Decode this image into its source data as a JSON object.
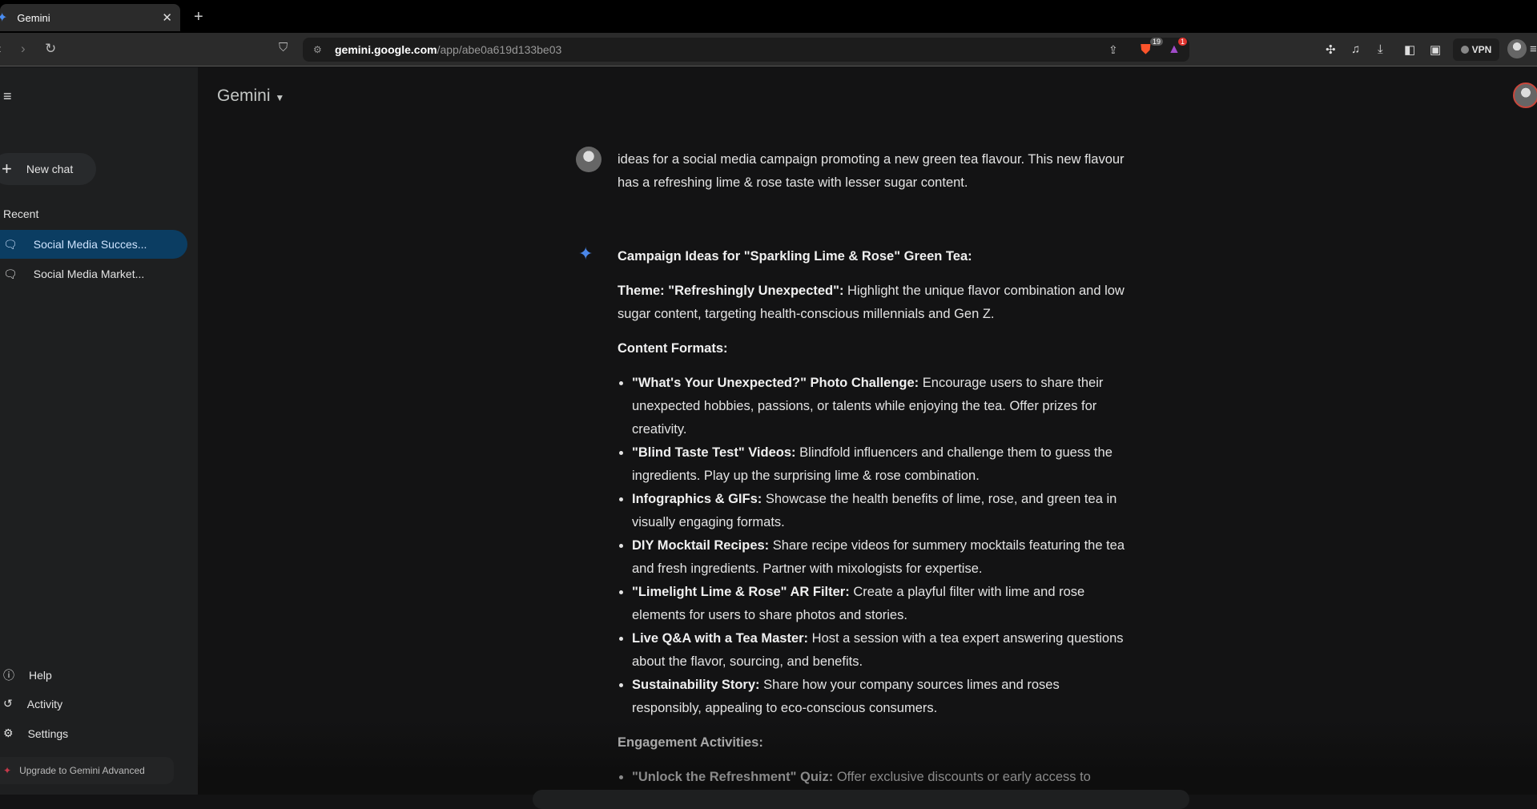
{
  "browser": {
    "tab_title": "Gemini",
    "url_host": "gemini.google.com",
    "url_path": "/app/abe0a619d133be03",
    "brave_badge": "19",
    "rewards_badge": "1",
    "vpn_label": "VPN"
  },
  "sidebar": {
    "new_chat": "New chat",
    "recent_label": "Recent",
    "recent": [
      {
        "label": "Social Media Succes..."
      },
      {
        "label": "Social Media Market..."
      }
    ],
    "help": "Help",
    "activity": "Activity",
    "settings": "Settings",
    "upgrade": "Upgrade to Gemini Advanced"
  },
  "header": {
    "title": "Gemini"
  },
  "prompt": "ideas for a social media campaign promoting a new green tea flavour. This new flavour has a refreshing lime & rose taste with lesser sugar content.",
  "response": {
    "heading": "Campaign Ideas for \"Sparkling Lime & Rose\" Green Tea:",
    "theme_label": "Theme: \"Refreshingly Unexpected\":",
    "theme_text": " Highlight the unique flavor combination and low sugar content, targeting health-conscious millennials and Gen Z.",
    "formats_heading": "Content Formats:",
    "formats": [
      {
        "title": "\"What's Your Unexpected?\" Photo Challenge:",
        "text": " Encourage users to share their unexpected hobbies, passions, or talents while enjoying the tea. Offer prizes for creativity."
      },
      {
        "title": "\"Blind Taste Test\" Videos:",
        "text": " Blindfold influencers and challenge them to guess the ingredients. Play up the surprising lime & rose combination."
      },
      {
        "title": "Infographics & GIFs:",
        "text": " Showcase the health benefits of lime, rose, and green tea in visually engaging formats."
      },
      {
        "title": "DIY Mocktail Recipes:",
        "text": " Share recipe videos for summery mocktails featuring the tea and fresh ingredients. Partner with mixologists for expertise."
      },
      {
        "title": "\"Limelight Lime & Rose\" AR Filter:",
        "text": " Create a playful filter with lime and rose elements for users to share photos and stories."
      },
      {
        "title": "Live Q&A with a Tea Master:",
        "text": " Host a session with a tea expert answering questions about the flavor, sourcing, and benefits."
      },
      {
        "title": "Sustainability Story:",
        "text": " Share how your company sources limes and roses responsibly, appealing to eco-conscious consumers."
      }
    ],
    "engagement_heading": "Engagement Activities:",
    "engagement": [
      {
        "title": "\"Unlock the Refreshment\" Quiz:",
        "text": " Offer exclusive discounts or early access to"
      }
    ]
  }
}
